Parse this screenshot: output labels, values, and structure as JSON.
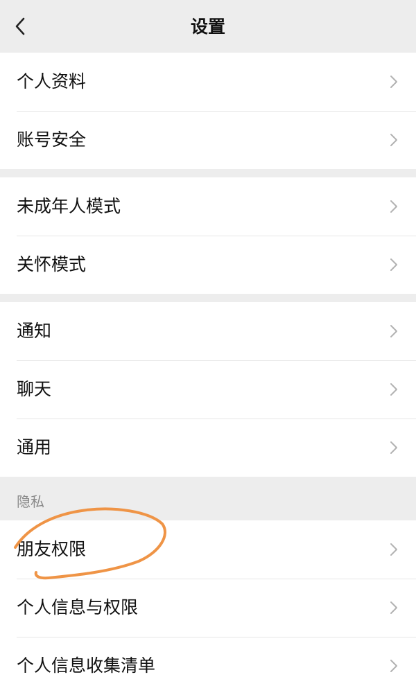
{
  "header": {
    "title": "设置",
    "back_icon": "chevron-left-icon"
  },
  "groups": [
    {
      "items": [
        {
          "label": "个人资料"
        },
        {
          "label": "账号安全"
        }
      ]
    },
    {
      "items": [
        {
          "label": "未成年人模式"
        },
        {
          "label": "关怀模式"
        }
      ]
    },
    {
      "items": [
        {
          "label": "通知"
        },
        {
          "label": "聊天"
        },
        {
          "label": "通用"
        }
      ]
    },
    {
      "items": [
        {
          "label": "朋友权限"
        },
        {
          "label": "个人信息与权限"
        },
        {
          "label": "个人信息收集清单"
        }
      ]
    }
  ],
  "sections": {
    "privacy_label": "隐私"
  },
  "icons": {
    "row_chevron": "chevron-right-icon"
  },
  "colors": {
    "background": "#ededed",
    "row_background": "#ffffff",
    "text_primary": "#111111",
    "text_secondary": "#8a8a8a",
    "chevron": "#b2b2b2",
    "annotation_stroke": "#ef9446"
  }
}
